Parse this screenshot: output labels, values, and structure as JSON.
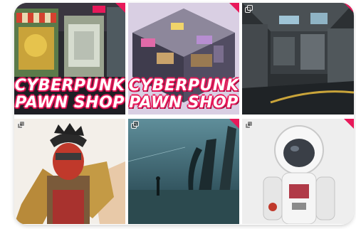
{
  "tiles": [
    {
      "id": "shop-exterior",
      "title_line1": "CYBERPUNK",
      "title_line2": "PAWN SHOP",
      "has_corner_badge": true,
      "icon": "stack-icon"
    },
    {
      "id": "shop-isometric",
      "title_line1": "CYBERPUNK",
      "title_line2": "PAWN SHOP",
      "has_corner_badge": true,
      "icon": "stack-icon"
    },
    {
      "id": "scifi-corridor",
      "has_corner_badge": true,
      "icon": "stack-icon"
    },
    {
      "id": "masked-warrior",
      "has_corner_badge": false,
      "icon": "stack-icon"
    },
    {
      "id": "swamp-scene",
      "has_corner_badge": true,
      "icon": "stack-icon"
    },
    {
      "id": "astronaut",
      "has_corner_badge": true,
      "icon": "stack-icon"
    }
  ],
  "colors": {
    "accent": "#e8195a",
    "card_bg": "#ffffff"
  }
}
